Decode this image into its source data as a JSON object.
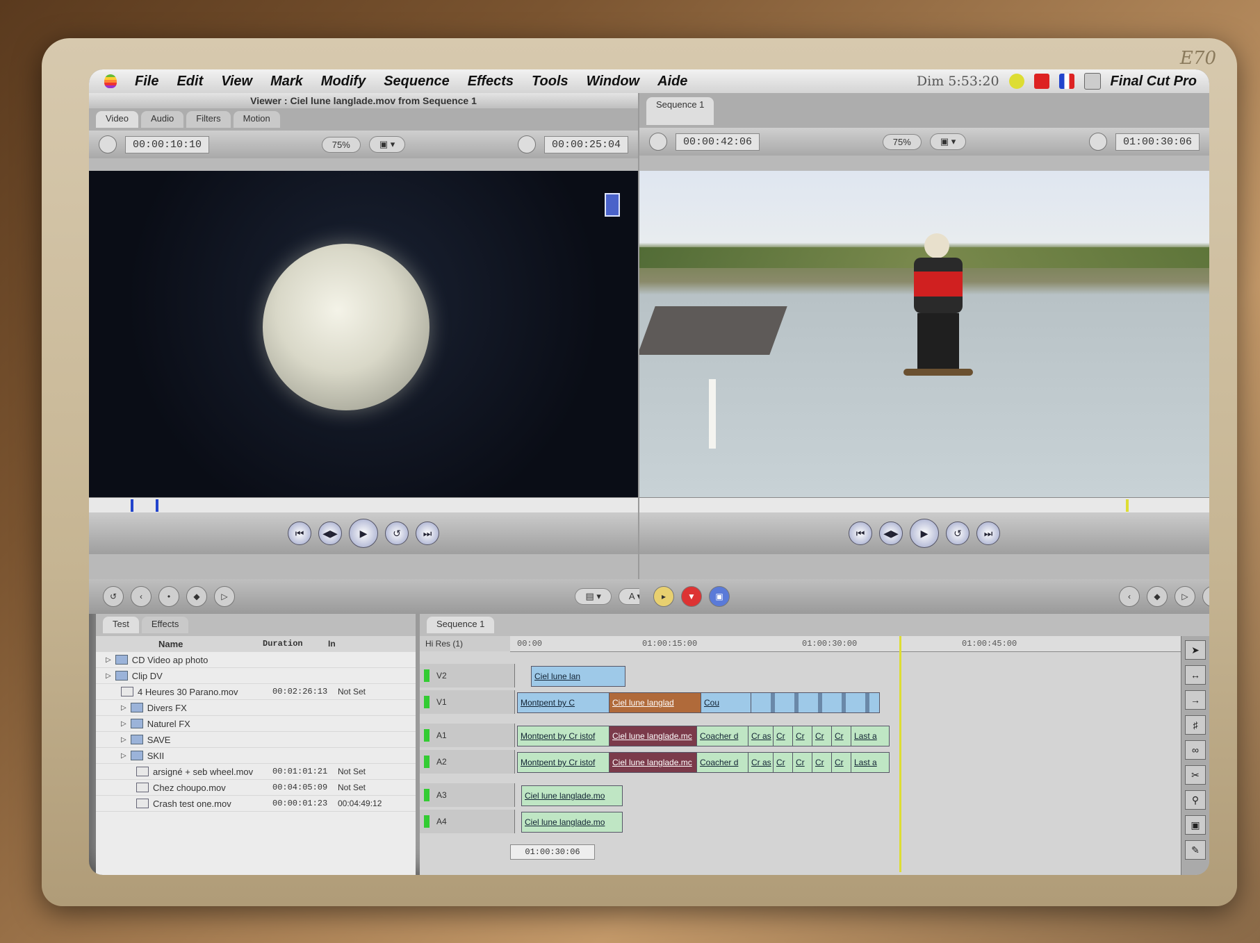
{
  "monitor": {
    "model": "E70"
  },
  "menubar": {
    "items": [
      "File",
      "Edit",
      "View",
      "Mark",
      "Modify",
      "Sequence",
      "Effects",
      "Tools",
      "Window",
      "Aide"
    ],
    "clock": "Dim 5:53:20",
    "app_name": "Final Cut Pro"
  },
  "viewer": {
    "title": "Viewer : Ciel lune langlade.mov from Sequence 1",
    "tabs": [
      "Video",
      "Audio",
      "Filters",
      "Motion"
    ],
    "timecode_duration": "00:00:10:10",
    "zoom": "75%",
    "timecode_current": "00:00:25:04"
  },
  "canvas": {
    "tab": "Sequence 1",
    "timecode_duration": "00:00:42:06",
    "zoom": "75%",
    "timecode_current": "01:00:30:06"
  },
  "browser": {
    "tabs": [
      "Test",
      "Effects"
    ],
    "columns": {
      "name": "Name",
      "duration": "Duration",
      "in": "In"
    },
    "rows": [
      {
        "name": "CD Video ap photo",
        "type": "folder",
        "depth": 0,
        "duration": "",
        "in": ""
      },
      {
        "name": "Clip DV",
        "type": "folder",
        "depth": 0,
        "duration": "",
        "in": ""
      },
      {
        "name": "4 Heures 30 Parano.mov",
        "type": "clip",
        "depth": 1,
        "duration": "00:02:26:13",
        "in": "Not Set"
      },
      {
        "name": "Divers FX",
        "type": "folder",
        "depth": 1,
        "duration": "",
        "in": ""
      },
      {
        "name": "Naturel FX",
        "type": "folder",
        "depth": 1,
        "duration": "",
        "in": ""
      },
      {
        "name": "SAVE",
        "type": "folder",
        "depth": 1,
        "duration": "",
        "in": ""
      },
      {
        "name": "SKII",
        "type": "folder",
        "depth": 1,
        "duration": "",
        "in": ""
      },
      {
        "name": "arsigné + seb wheel.mov",
        "type": "clip",
        "depth": 2,
        "duration": "00:01:01:21",
        "in": "Not Set"
      },
      {
        "name": "Chez choupo.mov",
        "type": "clip",
        "depth": 2,
        "duration": "00:04:05:09",
        "in": "Not Set"
      },
      {
        "name": "Crash test one.mov",
        "type": "clip",
        "depth": 2,
        "duration": "00:00:01:23",
        "in": "00:04:49:12"
      }
    ]
  },
  "timeline": {
    "tab": "Sequence 1",
    "resolution": "Hi Res (1)",
    "ruler": [
      "00:00",
      "01:00:15:00",
      "01:00:30:00",
      "01:00:45:00"
    ],
    "current_timecode": "01:00:30:06",
    "tracks": [
      "V2",
      "V1",
      "A1",
      "A2",
      "A3",
      "A4"
    ],
    "clips": {
      "v2": "Ciel lune lan",
      "v1": [
        "Montpent by C",
        "Ciel lune langlad",
        "Cou"
      ],
      "a1": [
        "Montpent by Cr istof",
        "Ciel lune langlade.mc",
        "Coacher d",
        "Cr as",
        "Cr",
        "Cr",
        "Cr",
        "Cr",
        "Last a"
      ],
      "a2": [
        "Montpent by Cr istof",
        "Ciel lune langlade.mc",
        "Coacher d",
        "Cr as",
        "Cr",
        "Cr",
        "Cr",
        "Cr",
        "Last a"
      ],
      "a3": "Ciel lune langlade.mo",
      "a4": "Ciel lune langlade.mo"
    }
  }
}
